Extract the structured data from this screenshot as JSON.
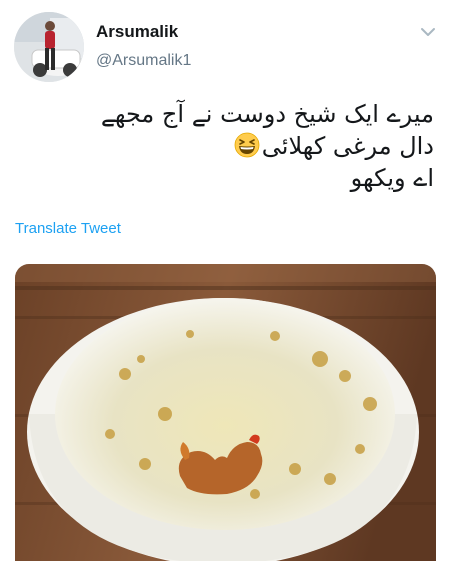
{
  "author": {
    "name": "Arsumalik",
    "handle": "@Arsumalik1"
  },
  "tweet": {
    "text_lines": [
      "میرے ایک شیخ دوست نے آج مجھے",
      "دال مرغی کھلائی",
      "اے ویکھو"
    ],
    "emoji": "grinning-squinting-face"
  },
  "translate_label": "Translate Tweet",
  "icons": {
    "more": "chevron-down-icon"
  },
  "media": {
    "subject": "white bowl with chicken shaped stain"
  },
  "colors": {
    "link": "#1da1f2",
    "handle": "#657786",
    "text": "#14171a"
  }
}
